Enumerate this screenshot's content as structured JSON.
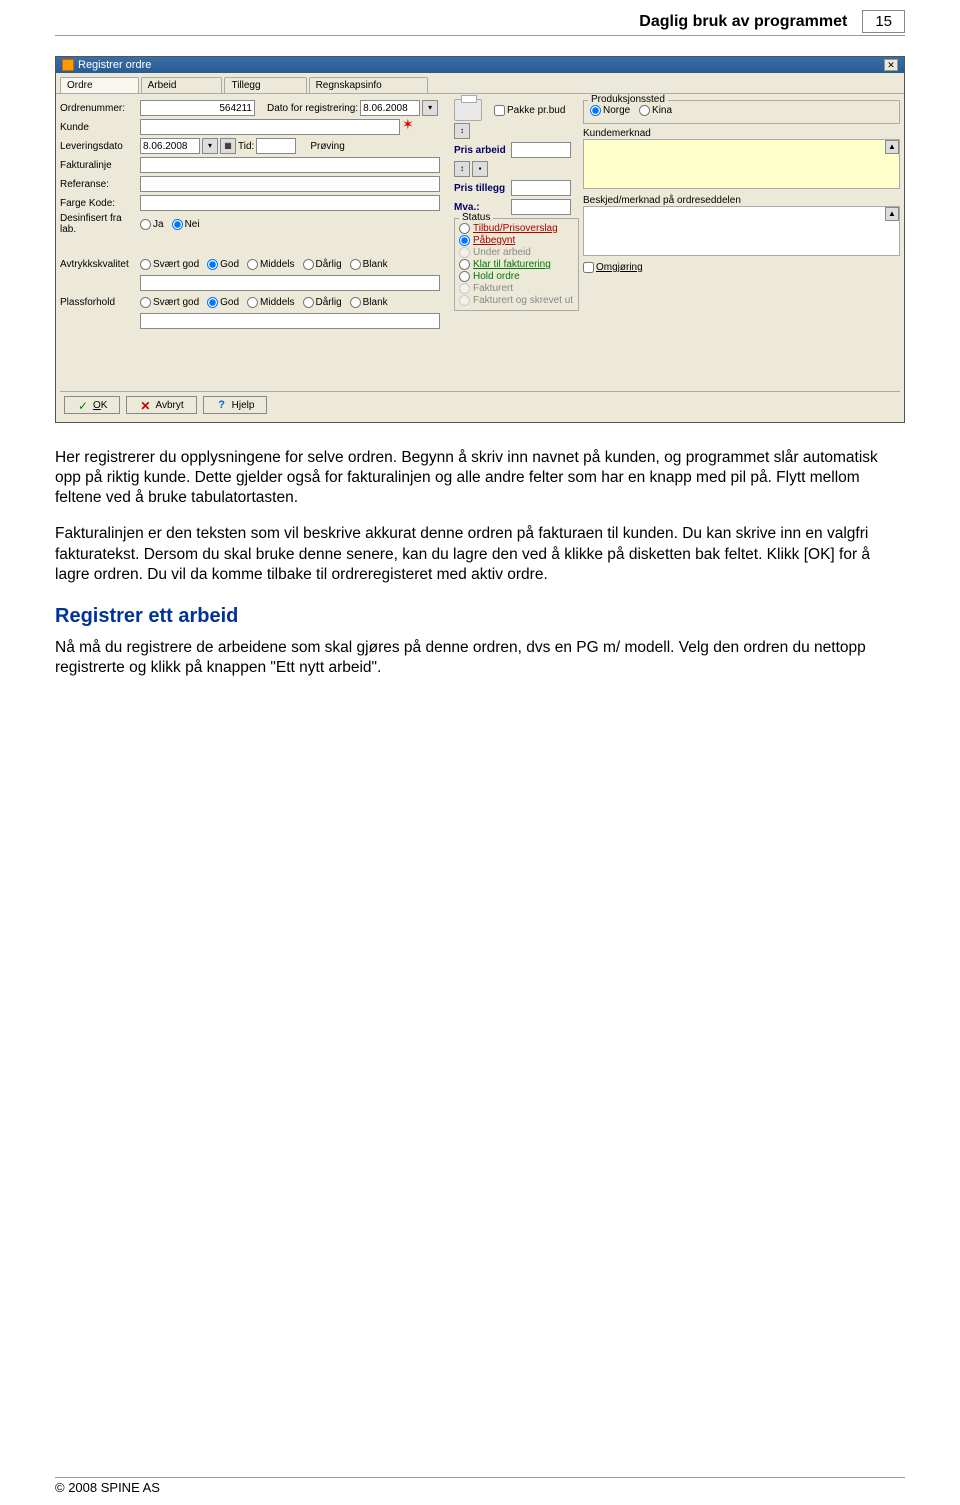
{
  "header": {
    "title": "Daglig bruk av programmet",
    "page_num": "15"
  },
  "win": {
    "title": "Registrer ordre",
    "tabs": [
      "Ordre",
      "Arbeid",
      "Tillegg",
      "Regnskapsinfo"
    ],
    "fields": {
      "ordrenummer_label": "Ordrenummer:",
      "ordrenummer_value": "564211",
      "dato_reg_label": "Dato for registrering:",
      "dato_reg_value": "8.06.2008",
      "kunde_label": "Kunde",
      "leveringsdato_label": "Leveringsdato",
      "leveringsdato_value": "8.06.2008",
      "tid_label": "Tid:",
      "proving_label": "Prøving",
      "fakturalinje_label": "Fakturalinje",
      "referanse_label": "Referanse:",
      "fargekode_label": "Farge Kode:",
      "desinfisert_label": "Desinfisert fra lab.",
      "avtrykk_label": "Avtrykkskvalitet",
      "plass_label": "Plassforhold",
      "ja": "Ja",
      "nei": "Nei",
      "svaert": "Svært god",
      "god": "God",
      "middels": "Middels",
      "darlig": "Dårlig",
      "blank": "Blank"
    },
    "mid": {
      "pakke": "Pakke pr.bud",
      "pris_arbeid": "Pris arbeid",
      "pris_tillegg": "Pris tillegg",
      "mva": "Mva.:",
      "status_title": "Status",
      "tilbud": "Tilbud/Prisoverslag",
      "pabegynt": "Påbegynt",
      "under": "Under arbeid",
      "klar": "Klar til fakturering",
      "hold": "Hold ordre",
      "fakturert": "Fakturert",
      "fakt_skrev": "Fakturert og skrevet ut"
    },
    "right": {
      "prod_title": "Produksjonssted",
      "norge": "Norge",
      "kina": "Kina",
      "kundemerknad": "Kundemerknad",
      "beskjed": "Beskjed/merknad på ordreseddelen",
      "omgjoring": "Omgjøring"
    },
    "buttons": {
      "ok": "OK",
      "avbryt": "Avbryt",
      "hjelp": "Hjelp"
    }
  },
  "body": {
    "p1": "Her registrerer du opplysningene for selve ordren. Begynn å skriv inn navnet på kunden, og programmet slår automatisk opp på riktig kunde. Dette gjelder også for fakturalinjen og alle andre felter som har en knapp med pil på. Flytt mellom feltene ved å bruke tabulatortasten.",
    "p2": "Fakturalinjen er den teksten som vil beskrive akkurat denne ordren på fakturaen til kunden. Du kan skrive inn en valgfri fakturatekst. Dersom du skal bruke denne senere, kan du lagre den ved å klikke på disketten bak feltet. Klikk [OK] for å lagre ordren. Du vil da komme tilbake til ordreregisteret med aktiv ordre.",
    "h2": "Registrer ett arbeid",
    "p3": "Nå må du registrere de arbeidene som skal gjøres på denne ordren, dvs en PG m/ modell. Velg den ordren du nettopp registrerte og klikk på knappen \"Ett nytt arbeid\"."
  },
  "footer": "© 2008 SPINE AS"
}
